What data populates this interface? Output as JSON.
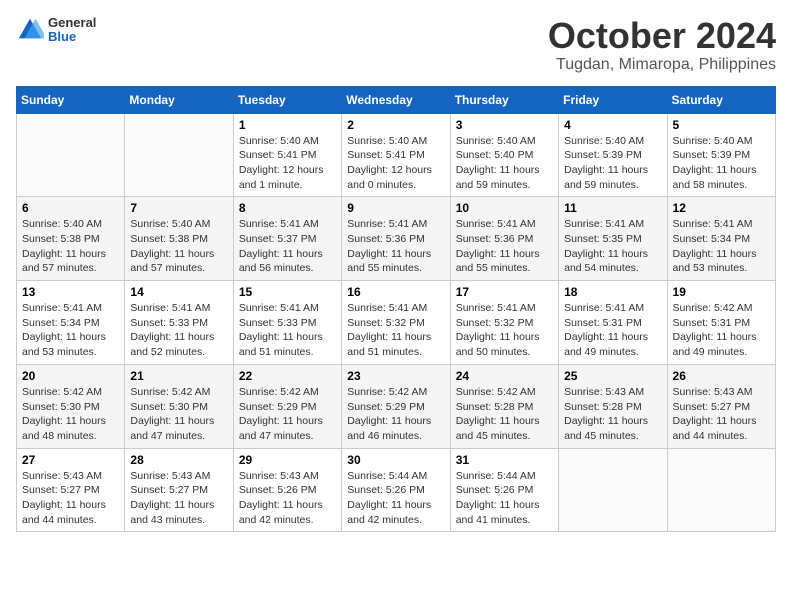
{
  "logo": {
    "general": "General",
    "blue": "Blue"
  },
  "title": "October 2024",
  "location": "Tugdan, Mimaropa, Philippines",
  "days_of_week": [
    "Sunday",
    "Monday",
    "Tuesday",
    "Wednesday",
    "Thursday",
    "Friday",
    "Saturday"
  ],
  "weeks": [
    [
      {
        "day": "",
        "sunrise": "",
        "sunset": "",
        "daylight": ""
      },
      {
        "day": "",
        "sunrise": "",
        "sunset": "",
        "daylight": ""
      },
      {
        "day": "1",
        "sunrise": "Sunrise: 5:40 AM",
        "sunset": "Sunset: 5:41 PM",
        "daylight": "Daylight: 12 hours and 1 minute."
      },
      {
        "day": "2",
        "sunrise": "Sunrise: 5:40 AM",
        "sunset": "Sunset: 5:41 PM",
        "daylight": "Daylight: 12 hours and 0 minutes."
      },
      {
        "day": "3",
        "sunrise": "Sunrise: 5:40 AM",
        "sunset": "Sunset: 5:40 PM",
        "daylight": "Daylight: 11 hours and 59 minutes."
      },
      {
        "day": "4",
        "sunrise": "Sunrise: 5:40 AM",
        "sunset": "Sunset: 5:39 PM",
        "daylight": "Daylight: 11 hours and 59 minutes."
      },
      {
        "day": "5",
        "sunrise": "Sunrise: 5:40 AM",
        "sunset": "Sunset: 5:39 PM",
        "daylight": "Daylight: 11 hours and 58 minutes."
      }
    ],
    [
      {
        "day": "6",
        "sunrise": "Sunrise: 5:40 AM",
        "sunset": "Sunset: 5:38 PM",
        "daylight": "Daylight: 11 hours and 57 minutes."
      },
      {
        "day": "7",
        "sunrise": "Sunrise: 5:40 AM",
        "sunset": "Sunset: 5:38 PM",
        "daylight": "Daylight: 11 hours and 57 minutes."
      },
      {
        "day": "8",
        "sunrise": "Sunrise: 5:41 AM",
        "sunset": "Sunset: 5:37 PM",
        "daylight": "Daylight: 11 hours and 56 minutes."
      },
      {
        "day": "9",
        "sunrise": "Sunrise: 5:41 AM",
        "sunset": "Sunset: 5:36 PM",
        "daylight": "Daylight: 11 hours and 55 minutes."
      },
      {
        "day": "10",
        "sunrise": "Sunrise: 5:41 AM",
        "sunset": "Sunset: 5:36 PM",
        "daylight": "Daylight: 11 hours and 55 minutes."
      },
      {
        "day": "11",
        "sunrise": "Sunrise: 5:41 AM",
        "sunset": "Sunset: 5:35 PM",
        "daylight": "Daylight: 11 hours and 54 minutes."
      },
      {
        "day": "12",
        "sunrise": "Sunrise: 5:41 AM",
        "sunset": "Sunset: 5:34 PM",
        "daylight": "Daylight: 11 hours and 53 minutes."
      }
    ],
    [
      {
        "day": "13",
        "sunrise": "Sunrise: 5:41 AM",
        "sunset": "Sunset: 5:34 PM",
        "daylight": "Daylight: 11 hours and 53 minutes."
      },
      {
        "day": "14",
        "sunrise": "Sunrise: 5:41 AM",
        "sunset": "Sunset: 5:33 PM",
        "daylight": "Daylight: 11 hours and 52 minutes."
      },
      {
        "day": "15",
        "sunrise": "Sunrise: 5:41 AM",
        "sunset": "Sunset: 5:33 PM",
        "daylight": "Daylight: 11 hours and 51 minutes."
      },
      {
        "day": "16",
        "sunrise": "Sunrise: 5:41 AM",
        "sunset": "Sunset: 5:32 PM",
        "daylight": "Daylight: 11 hours and 51 minutes."
      },
      {
        "day": "17",
        "sunrise": "Sunrise: 5:41 AM",
        "sunset": "Sunset: 5:32 PM",
        "daylight": "Daylight: 11 hours and 50 minutes."
      },
      {
        "day": "18",
        "sunrise": "Sunrise: 5:41 AM",
        "sunset": "Sunset: 5:31 PM",
        "daylight": "Daylight: 11 hours and 49 minutes."
      },
      {
        "day": "19",
        "sunrise": "Sunrise: 5:42 AM",
        "sunset": "Sunset: 5:31 PM",
        "daylight": "Daylight: 11 hours and 49 minutes."
      }
    ],
    [
      {
        "day": "20",
        "sunrise": "Sunrise: 5:42 AM",
        "sunset": "Sunset: 5:30 PM",
        "daylight": "Daylight: 11 hours and 48 minutes."
      },
      {
        "day": "21",
        "sunrise": "Sunrise: 5:42 AM",
        "sunset": "Sunset: 5:30 PM",
        "daylight": "Daylight: 11 hours and 47 minutes."
      },
      {
        "day": "22",
        "sunrise": "Sunrise: 5:42 AM",
        "sunset": "Sunset: 5:29 PM",
        "daylight": "Daylight: 11 hours and 47 minutes."
      },
      {
        "day": "23",
        "sunrise": "Sunrise: 5:42 AM",
        "sunset": "Sunset: 5:29 PM",
        "daylight": "Daylight: 11 hours and 46 minutes."
      },
      {
        "day": "24",
        "sunrise": "Sunrise: 5:42 AM",
        "sunset": "Sunset: 5:28 PM",
        "daylight": "Daylight: 11 hours and 45 minutes."
      },
      {
        "day": "25",
        "sunrise": "Sunrise: 5:43 AM",
        "sunset": "Sunset: 5:28 PM",
        "daylight": "Daylight: 11 hours and 45 minutes."
      },
      {
        "day": "26",
        "sunrise": "Sunrise: 5:43 AM",
        "sunset": "Sunset: 5:27 PM",
        "daylight": "Daylight: 11 hours and 44 minutes."
      }
    ],
    [
      {
        "day": "27",
        "sunrise": "Sunrise: 5:43 AM",
        "sunset": "Sunset: 5:27 PM",
        "daylight": "Daylight: 11 hours and 44 minutes."
      },
      {
        "day": "28",
        "sunrise": "Sunrise: 5:43 AM",
        "sunset": "Sunset: 5:27 PM",
        "daylight": "Daylight: 11 hours and 43 minutes."
      },
      {
        "day": "29",
        "sunrise": "Sunrise: 5:43 AM",
        "sunset": "Sunset: 5:26 PM",
        "daylight": "Daylight: 11 hours and 42 minutes."
      },
      {
        "day": "30",
        "sunrise": "Sunrise: 5:44 AM",
        "sunset": "Sunset: 5:26 PM",
        "daylight": "Daylight: 11 hours and 42 minutes."
      },
      {
        "day": "31",
        "sunrise": "Sunrise: 5:44 AM",
        "sunset": "Sunset: 5:26 PM",
        "daylight": "Daylight: 11 hours and 41 minutes."
      },
      {
        "day": "",
        "sunrise": "",
        "sunset": "",
        "daylight": ""
      },
      {
        "day": "",
        "sunrise": "",
        "sunset": "",
        "daylight": ""
      }
    ]
  ]
}
